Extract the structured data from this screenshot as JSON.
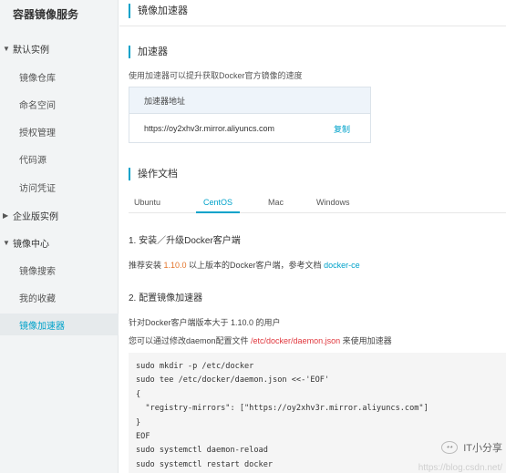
{
  "sidebar": {
    "title": "容器镜像服务",
    "groups": [
      {
        "caret": "▼",
        "label": "默认实例"
      },
      {
        "caret": "▶",
        "label": "企业版实例"
      },
      {
        "caret": "▼",
        "label": "镜像中心"
      }
    ],
    "items": [
      {
        "label": "镜像仓库"
      },
      {
        "label": "命名空间"
      },
      {
        "label": "授权管理"
      },
      {
        "label": "代码源"
      },
      {
        "label": "访问凭证"
      },
      {
        "label": "镜像搜索"
      },
      {
        "label": "我的收藏"
      },
      {
        "label": "镜像加速器"
      }
    ]
  },
  "main": {
    "page_title": "镜像加速器",
    "accelerator": {
      "section_title": "加速器",
      "description": "使用加速器可以提升获取Docker官方镜像的速度",
      "box_header": "加速器地址",
      "url": "https://oy2xhv3r.mirror.aliyuncs.com",
      "copy_label": "复制"
    },
    "docs": {
      "section_title": "操作文档",
      "tabs": [
        "Ubuntu",
        "CentOS",
        "Mac",
        "Windows"
      ],
      "active_tab": "CentOS",
      "step1_title": "1. 安装／升级Docker客户端",
      "step1_text_a": "推荐安装 ",
      "step1_version": "1.10.0",
      "step1_text_b": " 以上版本的Docker客户端，参考文档 ",
      "step1_link": "docker-ce",
      "step2_title": "2. 配置镜像加速器",
      "step2_line1": "针对Docker客户端版本大于 1.10.0 的用户",
      "step2_line2_a": "您可以通过修改daemon配置文件 ",
      "step2_path": "/etc/docker/daemon.json",
      "step2_line2_b": " 来使用加速器",
      "code_lines": [
        "sudo mkdir -p /etc/docker",
        "sudo tee /etc/docker/daemon.json <<-'EOF'",
        "{",
        "  \"registry-mirrors\": [\"https://oy2xhv3r.mirror.aliyuncs.com\"]",
        "}",
        "EOF",
        "sudo systemctl daemon-reload",
        "sudo systemctl restart docker"
      ]
    }
  },
  "watermark": {
    "name": "IT小分享",
    "url": "https://blog.csdn.net/"
  },
  "colors": {
    "accent": "#00a2ca",
    "version_highlight": "#e3742a",
    "path_highlight": "#e0373d"
  }
}
